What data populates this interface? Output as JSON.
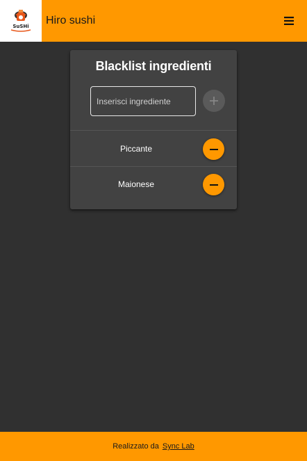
{
  "colors": {
    "accent": "#ff9800",
    "background": "#303030",
    "card": "#424242",
    "disabled_button": "#5a5a5a"
  },
  "header": {
    "logo_text": "SuSHi",
    "title": "Hiro sushi",
    "menu_icon": "hamburger-menu-icon"
  },
  "blacklist": {
    "title": "Blacklist ingredienti",
    "input": {
      "placeholder": "Inserisci ingrediente",
      "value": ""
    },
    "add_icon": "plus-icon",
    "remove_icon": "minus-icon",
    "items": [
      {
        "label": "Piccante"
      },
      {
        "label": "Maionese"
      }
    ]
  },
  "footer": {
    "text": "Realizzato da",
    "link_text": "Sync Lab"
  }
}
